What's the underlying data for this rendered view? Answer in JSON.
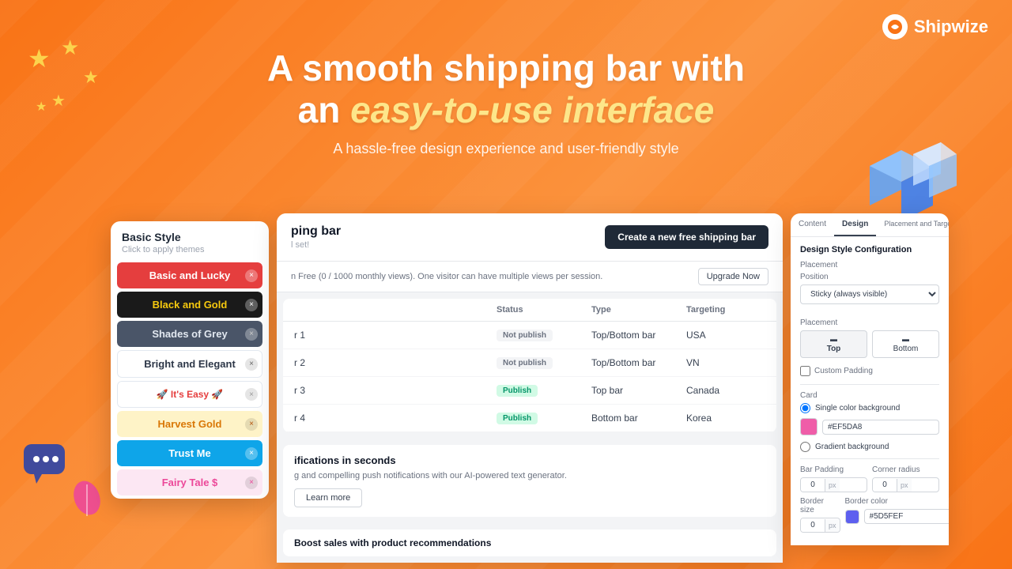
{
  "brand": {
    "name": "Shipwize",
    "logo_symbol": "🚢"
  },
  "heading": {
    "line1": "A smooth shipping bar with",
    "line2_prefix": "an ",
    "line2_accent": "easy-to-use interface",
    "subtext": "A hassle-free design experience and user-friendly style"
  },
  "basic_style_panel": {
    "title": "Basic Style",
    "subtitle": "Click to apply themes",
    "themes": [
      {
        "id": "basic-lucky",
        "label": "Basic and Lucky",
        "class": "theme-basic-lucky"
      },
      {
        "id": "black-gold",
        "label": "Black and Gold",
        "class": "theme-black-gold"
      },
      {
        "id": "shades-grey",
        "label": "Shades of Grey",
        "class": "theme-shades-grey"
      },
      {
        "id": "bright-elegant",
        "label": "Bright and Elegant",
        "class": "theme-bright-elegant"
      },
      {
        "id": "its-easy",
        "label": "🚀 It's Easy 🚀",
        "class": "theme-its-easy"
      },
      {
        "id": "harvest-gold",
        "label": "Harvest Gold",
        "class": "theme-harvest-gold"
      },
      {
        "id": "trust-me",
        "label": "Trust Me",
        "class": "theme-trust-me"
      },
      {
        "id": "fairy-tale",
        "label": "Fairy Tale $",
        "class": "theme-fairy-tale"
      }
    ]
  },
  "main_panel": {
    "title": "ping bar",
    "create_btn": "Create a new free shipping bar",
    "free_notice": "n Free (0 / 1000 monthly views). One visitor can have multiple views per session.",
    "upgrade_btn": "Upgrade Now",
    "table": {
      "headers": [
        "",
        "Status",
        "Type",
        "Targeting"
      ],
      "rows": [
        {
          "name": "r 1",
          "status": "Not publish",
          "status_class": "status-not-publish",
          "type": "Top/Bottom bar",
          "targeting": "USA"
        },
        {
          "name": "r 2",
          "status": "Not publish",
          "status_class": "status-not-publish",
          "type": "Top/Bottom bar",
          "targeting": "VN"
        },
        {
          "name": "r 3",
          "status": "Publish",
          "status_class": "status-publish",
          "type": "Top bar",
          "targeting": "Canada"
        },
        {
          "name": "r 4",
          "status": "Publish",
          "status_class": "status-publish",
          "type": "Bottom bar",
          "targeting": "Korea"
        }
      ]
    },
    "push_section": {
      "title": "ifications in seconds",
      "desc": "g and compelling push notifications with our AI-powered text generator.",
      "learn_more": "Learn more"
    },
    "boost_section": {
      "title": "Boost sales with product recommendations"
    }
  },
  "design_panel": {
    "tabs": [
      "Content",
      "Design",
      "Placement and Targeting"
    ],
    "active_tab": "Design",
    "section_title": "Design Style Configuration",
    "placement": {
      "label": "Placement",
      "position_label": "Position",
      "position_value": "Sticky (always visible)",
      "placement_label": "Placement",
      "top_btn": "Top",
      "bottom_btn": "Bottom",
      "custom_padding": "Custom Padding"
    },
    "card": {
      "label": "Card",
      "single_color_label": "Single color background",
      "color_hex": "#EF5DA8",
      "gradient_label": "Gradient background"
    },
    "bar_padding": {
      "label": "Bar Padding",
      "value": "0",
      "unit": "px"
    },
    "corner_radius": {
      "label": "Corner radius",
      "value": "0",
      "unit": "px"
    },
    "border_size": {
      "label": "Border size",
      "value": "0",
      "unit": "px"
    },
    "border_color": {
      "label": "Border color",
      "hex": "#5D5FEF",
      "swatch_color": "#5D5FEF"
    }
  }
}
